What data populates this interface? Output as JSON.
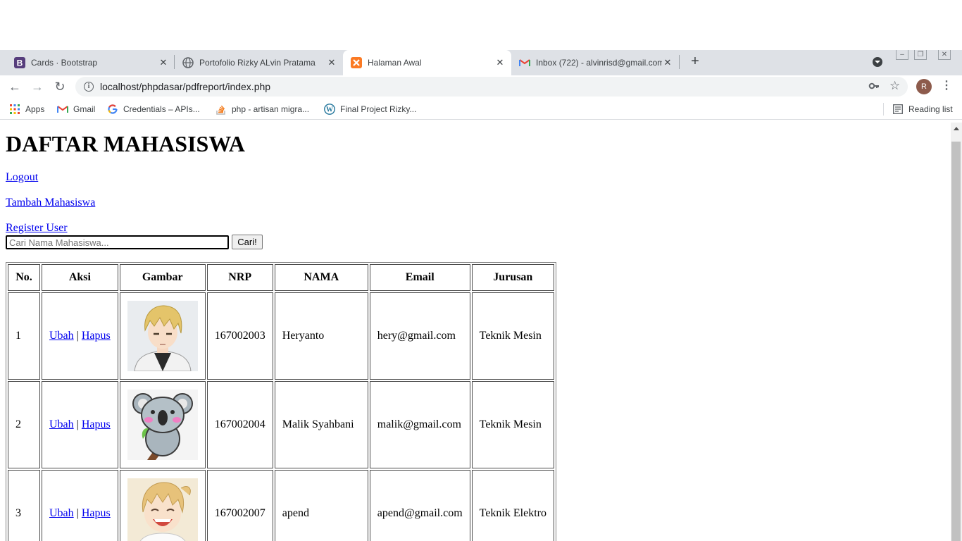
{
  "browser": {
    "tabs": [
      {
        "title": "Cards · Bootstrap",
        "icon": "bootstrap-icon",
        "active": false
      },
      {
        "title": "Portofolio Rizky ALvin Pratama",
        "icon": "globe-icon",
        "active": false
      },
      {
        "title": "Halaman Awal",
        "icon": "xampp-icon",
        "active": true
      },
      {
        "title": "Inbox (722) - alvinrisd@gmail.com",
        "icon": "gmail-icon",
        "active": false
      }
    ],
    "close_glyph": "✕",
    "new_tab_glyph": "+",
    "url": "localhost/phpdasar/pdfreport/index.php",
    "profile_initial": "R",
    "bookmarks": [
      {
        "label": "Apps",
        "icon": "apps-grid-icon"
      },
      {
        "label": "Gmail",
        "icon": "gmail-icon"
      },
      {
        "label": "Credentials – APIs...",
        "icon": "google-icon"
      },
      {
        "label": "php - artisan migra...",
        "icon": "stackoverflow-icon"
      },
      {
        "label": "Final Project Rizky...",
        "icon": "wordpress-icon"
      }
    ],
    "reading_list": "Reading list",
    "colors": {
      "tab_strip": "#dee1e6",
      "omnibox": "#f1f3f4",
      "link": "#0000ee"
    }
  },
  "page": {
    "title": "DAFTAR MAHASISWA",
    "links": {
      "logout": "Logout",
      "add": "Tambah Mahasiswa",
      "register": "Register User"
    },
    "search": {
      "placeholder": "Cari Nama Mahasiswa...",
      "value": "",
      "button": "Cari!"
    },
    "table": {
      "headers": [
        "No.",
        "Aksi",
        "Gambar",
        "NRP",
        "NAMA",
        "Email",
        "Jurusan"
      ],
      "action_edit": "Ubah",
      "action_sep": "|",
      "action_delete": "Hapus",
      "rows": [
        {
          "no": "1",
          "image": "anime-boy-blond-avatar",
          "nrp": "167002003",
          "nama": "Heryanto",
          "email": "hery@gmail.com",
          "jurusan": "Teknik Mesin"
        },
        {
          "no": "2",
          "image": "koala-cartoon-avatar",
          "nrp": "167002004",
          "nama": "Malik Syahbani",
          "email": "malik@gmail.com",
          "jurusan": "Teknik Mesin"
        },
        {
          "no": "3",
          "image": "anime-laughing-avatar",
          "nrp": "167002007",
          "nama": "apend",
          "email": "apend@gmail.com",
          "jurusan": "Teknik Elektro"
        }
      ]
    }
  }
}
